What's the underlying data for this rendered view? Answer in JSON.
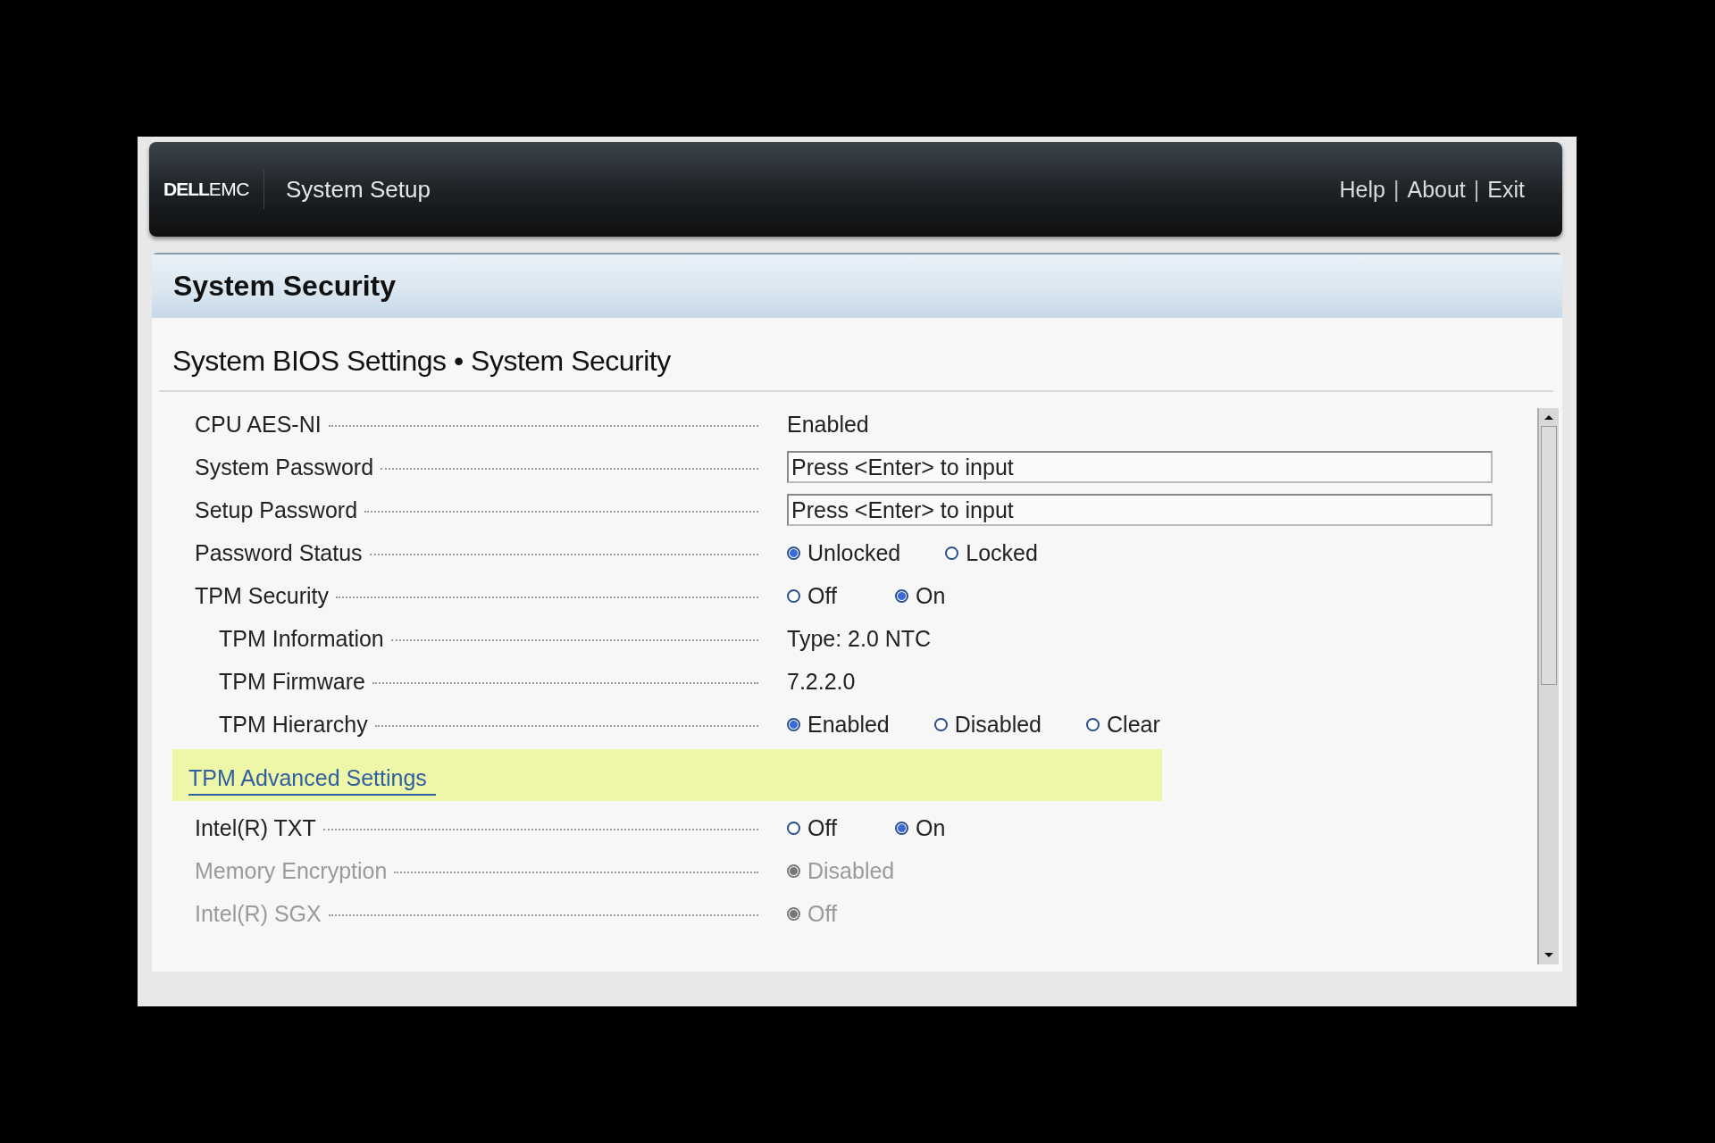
{
  "header": {
    "brand": "DELL",
    "brand_suffix": "EMC",
    "title": "System Setup",
    "links": [
      {
        "label": "Help"
      },
      {
        "label": "About"
      },
      {
        "label": "Exit"
      }
    ],
    "separator": "|"
  },
  "page_title": "System Security",
  "breadcrumb": "System BIOS Settings • System Security",
  "settings": [
    {
      "kind": "text",
      "label": "CPU AES-NI",
      "value": "Enabled",
      "disabled": false
    },
    {
      "kind": "input",
      "label": "System Password",
      "value": "Press <Enter> to input",
      "disabled": false
    },
    {
      "kind": "input",
      "label": "Setup Password",
      "value": "Press <Enter> to input",
      "disabled": false
    },
    {
      "kind": "radio",
      "label": "Password Status",
      "disabled": false,
      "options": [
        {
          "label": "Unlocked",
          "selected": true
        },
        {
          "label": "Locked",
          "selected": false
        }
      ]
    },
    {
      "kind": "radio",
      "label": "TPM Security",
      "disabled": false,
      "options": [
        {
          "label": "Off",
          "selected": false
        },
        {
          "label": "On",
          "selected": true
        }
      ],
      "children": [
        {
          "kind": "text",
          "label": "TPM Information",
          "value": "Type: 2.0  NTC",
          "disabled": false
        },
        {
          "kind": "text",
          "label": "TPM Firmware",
          "value": "7.2.2.0",
          "disabled": false
        },
        {
          "kind": "radio",
          "label": "TPM Hierarchy",
          "disabled": false,
          "options": [
            {
              "label": "Enabled",
              "selected": true
            },
            {
              "label": "Disabled",
              "selected": false
            },
            {
              "label": "Clear",
              "selected": false
            }
          ]
        }
      ]
    },
    {
      "kind": "link",
      "label": "TPM Advanced Settings",
      "selected": true
    },
    {
      "kind": "radio",
      "label": "Intel(R) TXT",
      "disabled": false,
      "options": [
        {
          "label": "Off",
          "selected": false
        },
        {
          "label": "On",
          "selected": true
        }
      ]
    },
    {
      "kind": "radio",
      "label": "Memory Encryption",
      "disabled": true,
      "options": [
        {
          "label": "Disabled",
          "selected": true
        }
      ]
    },
    {
      "kind": "radio",
      "label": "Intel(R) SGX",
      "disabled": true,
      "options": [
        {
          "label": "Off",
          "selected": true
        }
      ]
    }
  ]
}
